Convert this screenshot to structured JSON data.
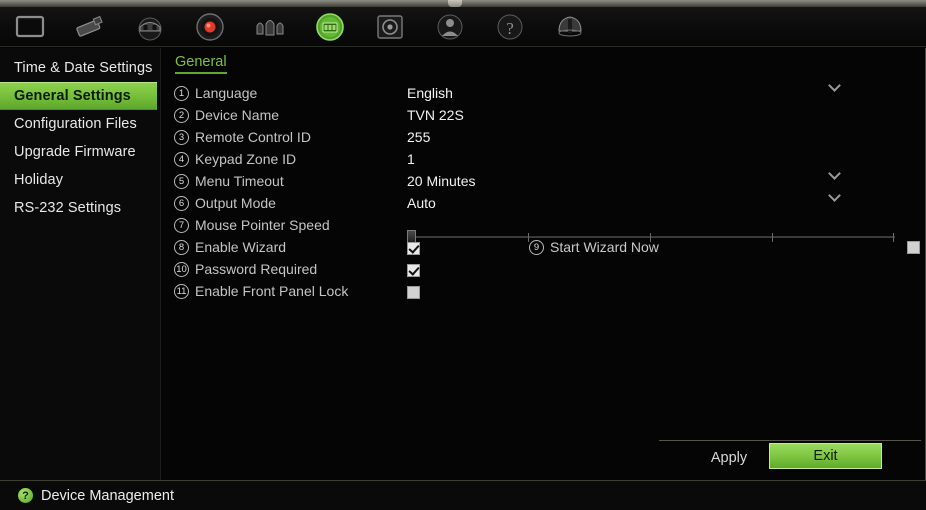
{
  "toolbar": {
    "items": [
      {
        "name": "display-icon",
        "label": "Display"
      },
      {
        "name": "camera-icon",
        "label": "Camera"
      },
      {
        "name": "network-icon",
        "label": "Network"
      },
      {
        "name": "record-icon",
        "label": "Record"
      },
      {
        "name": "alarm-icon",
        "label": "Alarm"
      },
      {
        "name": "device-management-icon",
        "label": "Device Management"
      },
      {
        "name": "storage-icon",
        "label": "Storage"
      },
      {
        "name": "user-icon",
        "label": "User"
      },
      {
        "name": "info-icon",
        "label": "Information"
      },
      {
        "name": "shutdown-icon",
        "label": "Shutdown"
      }
    ],
    "active_index": 5
  },
  "sidebar": {
    "items": [
      {
        "label": "Time & Date Settings",
        "selected": false
      },
      {
        "label": "General Settings",
        "selected": true
      },
      {
        "label": "Configuration Files",
        "selected": false
      },
      {
        "label": "Upgrade Firmware",
        "selected": false
      },
      {
        "label": "Holiday",
        "selected": false
      },
      {
        "label": "RS-232 Settings",
        "selected": false
      }
    ]
  },
  "tab": {
    "label": "General"
  },
  "form": {
    "rows": [
      {
        "num": "1",
        "label": "Language",
        "value": "English",
        "type": "dropdown"
      },
      {
        "num": "2",
        "label": "Device Name",
        "value": "TVN 22S",
        "type": "text"
      },
      {
        "num": "3",
        "label": "Remote Control ID",
        "value": "255",
        "type": "text"
      },
      {
        "num": "4",
        "label": "Keypad Zone ID",
        "value": "1",
        "type": "text"
      },
      {
        "num": "5",
        "label": "Menu Timeout",
        "value": "20 Minutes",
        "type": "dropdown"
      },
      {
        "num": "6",
        "label": "Output Mode",
        "value": "Auto",
        "type": "dropdown"
      },
      {
        "num": "7",
        "label": "Mouse Pointer Speed",
        "value": "",
        "type": "slider"
      },
      {
        "num": "8",
        "label": "Enable Wizard",
        "value": "",
        "type": "checkbox",
        "checked": true
      },
      {
        "num": "10",
        "label": "Password Required",
        "value": "",
        "type": "checkbox",
        "checked": true
      },
      {
        "num": "11",
        "label": "Enable Front Panel Lock",
        "value": "",
        "type": "checkbox",
        "checked": false
      }
    ],
    "start_wizard": {
      "num": "9",
      "label": "Start Wizard Now",
      "checked": false
    },
    "slider": {
      "value": 0,
      "min": 0,
      "max": 4,
      "ticks": 5
    }
  },
  "buttons": {
    "apply": "Apply",
    "exit": "Exit"
  },
  "status": {
    "icon": "help-icon",
    "text": "Device Management"
  },
  "colors": {
    "accent_green": "#7dc242",
    "selected_green": "#79c23c",
    "background": "#050505",
    "text": "#e8e8e8"
  }
}
